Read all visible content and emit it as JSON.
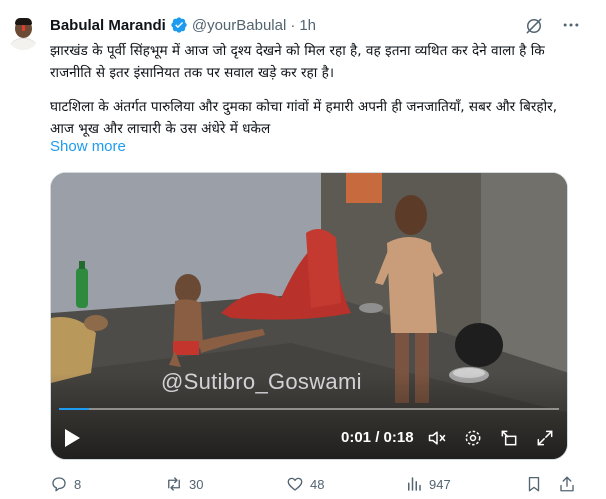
{
  "tweet": {
    "author_name": "Babulal Marandi",
    "handle": "@yourBabulal",
    "separator": "·",
    "time": "1h",
    "paragraph1": "झारखंड के पूर्वी सिंहभूम में आज जो दृश्य देखने को मिल रहा है, वह इतना व्यथित कर देने वाला है कि राजनीति से इतर इंसानियत तक पर सवाल खड़े कर रहा है।",
    "paragraph2": "घाटशिला के अंतर्गत पारुलिया और दुमका कोचा गांवों में हमारी अपनी ही जनजातियाँ, सबर और बिरहोर, आज भूख और लाचारी के उस अंधेरे में धकेल",
    "show_more": "Show more"
  },
  "video": {
    "watermark": "@Sutibro_Goswami",
    "timer": "0:01 / 0:18",
    "progress": 0.06
  },
  "actions": {
    "replies": "8",
    "reposts": "30",
    "likes": "48",
    "views": "947"
  },
  "colors": {
    "accent": "#1d9bf0",
    "secondary_text": "#536471",
    "primary_text": "#0f1419"
  },
  "icons": [
    "verified-badge-icon",
    "grok-icon",
    "more-icon",
    "play-icon",
    "captions-icon",
    "mute-icon",
    "settings-icon",
    "expand-icon",
    "fullscreen-icon",
    "reply-icon",
    "repost-icon",
    "like-icon",
    "views-icon",
    "bookmark-icon",
    "share-icon"
  ]
}
